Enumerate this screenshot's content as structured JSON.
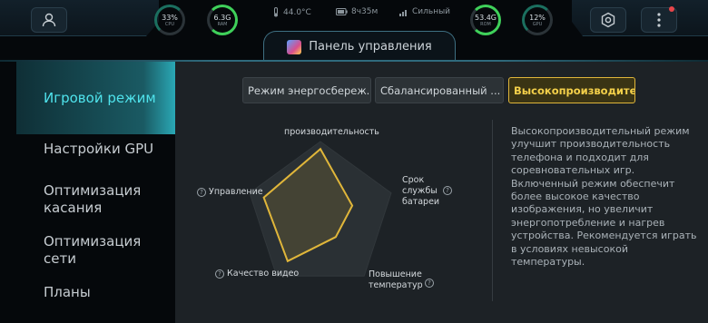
{
  "status_bar": {
    "cpu": {
      "value": "33%",
      "label": "CPU"
    },
    "ram": {
      "value": "6.3G",
      "label": "RAM"
    },
    "temperature": "44.0°C",
    "battery_time": "8ч35м",
    "signal": "Сильный",
    "rom": {
      "value": "53.4G",
      "label": "ROM"
    },
    "gpu": {
      "value": "12%",
      "label": "GPU"
    }
  },
  "header": {
    "title": "Панель управления"
  },
  "sidebar": {
    "items": [
      {
        "label": "Игровой режим"
      },
      {
        "label": "Настройки GPU"
      },
      {
        "label": "Оптимизация касания"
      },
      {
        "label": "Оптимизация сети"
      },
      {
        "label": "Планы"
      }
    ]
  },
  "modes": [
    {
      "label": "Режим энергосбереж..."
    },
    {
      "label": "Сбалансированный ..."
    },
    {
      "label": "Высокопроизводите..."
    }
  ],
  "radar": {
    "labels": {
      "performance": "производительность",
      "battery": "Срок службы батареи",
      "heating": "Повышение температур",
      "video": "Качество видео",
      "control": "Управление"
    },
    "values": {
      "performance": 0.9,
      "battery": 0.45,
      "heating": 0.35,
      "video": 0.75,
      "control": 0.8
    },
    "accent": "#e0b63a"
  },
  "description": "Высокопроизводительный режим улучшит производительность телефона и подходит для соревновательных игр. Включенный режим обеспечит более высокое качество изображения, но увеличит энергопотребление и нагрев устройства. Рекомендуется играть в условиях невысокой температуры."
}
